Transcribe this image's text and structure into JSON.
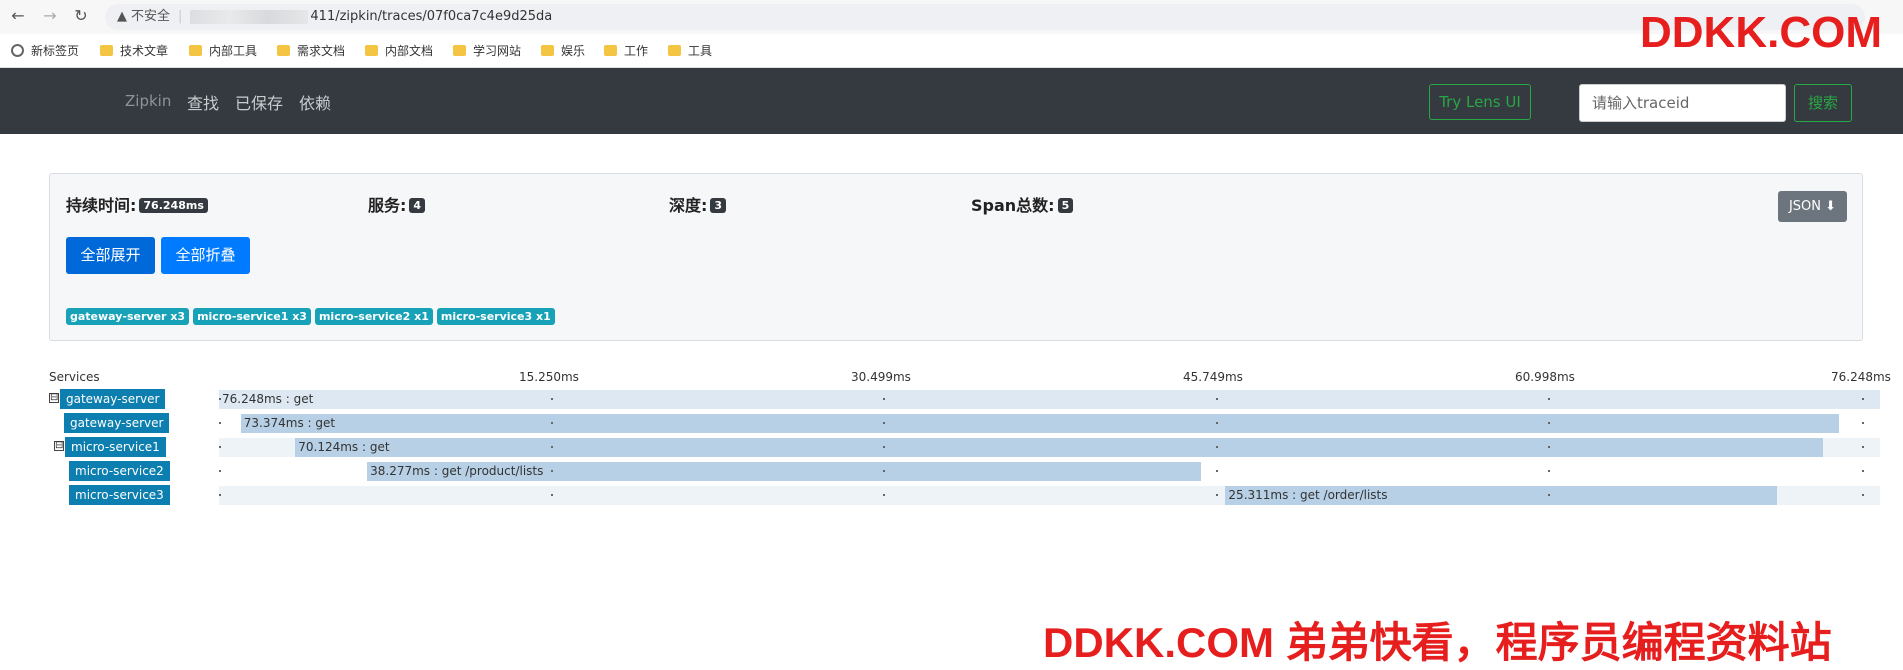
{
  "browser": {
    "url_warning": "不安全",
    "url_path": "411/zipkin/traces/07f0ca7c4e9d25da",
    "bookmarks": [
      "新标签页",
      "技术文章",
      "内部工具",
      "需求文档",
      "内部文档",
      "学习网站",
      "娱乐",
      "工作",
      "工具"
    ]
  },
  "navbar": {
    "brand": "Zipkin",
    "links": [
      "查找",
      "已保存",
      "依赖"
    ],
    "lens_button": "Try Lens UI",
    "search_placeholder": "请输入traceid",
    "search_button": "搜索"
  },
  "summary": {
    "duration_label": "持续时间:",
    "duration_value": "76.248ms",
    "services_label": "服务:",
    "services_value": "4",
    "depth_label": "深度:",
    "depth_value": "3",
    "span_total_label": "Span总数:",
    "span_total_value": "5",
    "json_button": "JSON",
    "expand_all": "全部展开",
    "collapse_all": "全部折叠",
    "service_badges": [
      "gateway-server x3",
      "micro-service1 x3",
      "micro-service2 x1",
      "micro-service3 x1"
    ]
  },
  "timeline": {
    "services_header": "Services",
    "ticks": [
      "15.250ms",
      "30.499ms",
      "45.749ms",
      "60.998ms",
      "76.248ms"
    ],
    "spans": [
      {
        "service": "gateway-server",
        "label": "76.248ms : get",
        "start_ms": 0,
        "duration_ms": 76.248,
        "toggle": "⊟"
      },
      {
        "service": "gateway-server",
        "label": "73.374ms : get",
        "start_ms": 1.0,
        "duration_ms": 73.374,
        "toggle": ""
      },
      {
        "service": "micro-service1",
        "label": "70.124ms : get",
        "start_ms": 3.5,
        "duration_ms": 70.124,
        "toggle": "⊟"
      },
      {
        "service": "micro-service2",
        "label": "38.277ms : get /product/lists",
        "start_ms": 6.8,
        "duration_ms": 38.277,
        "toggle": ""
      },
      {
        "service": "micro-service3",
        "label": "25.311ms : get /order/lists",
        "start_ms": 46.2,
        "duration_ms": 25.311,
        "toggle": ""
      }
    ]
  },
  "watermarks": {
    "top": "DDKK.COM",
    "bottom": "DDKK.COM 弟弟快看，程序员编程资料站"
  },
  "colors": {
    "navbar_bg": "#343a40",
    "success": "#28a745",
    "primary": "#007bff",
    "info": "#17a2b8",
    "service_label_bg": "#0c7fb0",
    "span_bar": "#b7d0e5",
    "watermark": "#e61e1e"
  }
}
